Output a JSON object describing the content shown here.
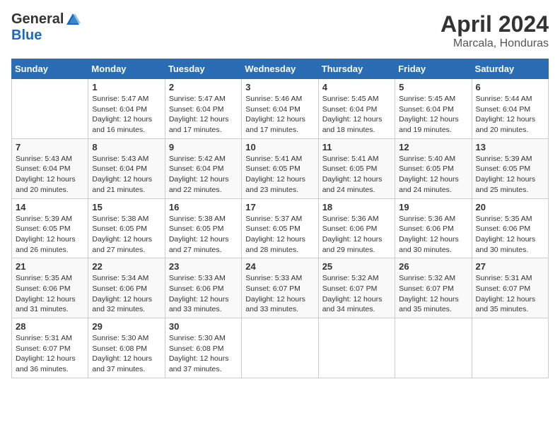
{
  "logo": {
    "general": "General",
    "blue": "Blue"
  },
  "header": {
    "month": "April 2024",
    "location": "Marcala, Honduras"
  },
  "days_of_week": [
    "Sunday",
    "Monday",
    "Tuesday",
    "Wednesday",
    "Thursday",
    "Friday",
    "Saturday"
  ],
  "weeks": [
    [
      {
        "day": "",
        "sunrise": "",
        "sunset": "",
        "daylight": ""
      },
      {
        "day": "1",
        "sunrise": "Sunrise: 5:47 AM",
        "sunset": "Sunset: 6:04 PM",
        "daylight": "Daylight: 12 hours and 16 minutes."
      },
      {
        "day": "2",
        "sunrise": "Sunrise: 5:47 AM",
        "sunset": "Sunset: 6:04 PM",
        "daylight": "Daylight: 12 hours and 17 minutes."
      },
      {
        "day": "3",
        "sunrise": "Sunrise: 5:46 AM",
        "sunset": "Sunset: 6:04 PM",
        "daylight": "Daylight: 12 hours and 17 minutes."
      },
      {
        "day": "4",
        "sunrise": "Sunrise: 5:45 AM",
        "sunset": "Sunset: 6:04 PM",
        "daylight": "Daylight: 12 hours and 18 minutes."
      },
      {
        "day": "5",
        "sunrise": "Sunrise: 5:45 AM",
        "sunset": "Sunset: 6:04 PM",
        "daylight": "Daylight: 12 hours and 19 minutes."
      },
      {
        "day": "6",
        "sunrise": "Sunrise: 5:44 AM",
        "sunset": "Sunset: 6:04 PM",
        "daylight": "Daylight: 12 hours and 20 minutes."
      }
    ],
    [
      {
        "day": "7",
        "sunrise": "Sunrise: 5:43 AM",
        "sunset": "Sunset: 6:04 PM",
        "daylight": "Daylight: 12 hours and 20 minutes."
      },
      {
        "day": "8",
        "sunrise": "Sunrise: 5:43 AM",
        "sunset": "Sunset: 6:04 PM",
        "daylight": "Daylight: 12 hours and 21 minutes."
      },
      {
        "day": "9",
        "sunrise": "Sunrise: 5:42 AM",
        "sunset": "Sunset: 6:04 PM",
        "daylight": "Daylight: 12 hours and 22 minutes."
      },
      {
        "day": "10",
        "sunrise": "Sunrise: 5:41 AM",
        "sunset": "Sunset: 6:05 PM",
        "daylight": "Daylight: 12 hours and 23 minutes."
      },
      {
        "day": "11",
        "sunrise": "Sunrise: 5:41 AM",
        "sunset": "Sunset: 6:05 PM",
        "daylight": "Daylight: 12 hours and 24 minutes."
      },
      {
        "day": "12",
        "sunrise": "Sunrise: 5:40 AM",
        "sunset": "Sunset: 6:05 PM",
        "daylight": "Daylight: 12 hours and 24 minutes."
      },
      {
        "day": "13",
        "sunrise": "Sunrise: 5:39 AM",
        "sunset": "Sunset: 6:05 PM",
        "daylight": "Daylight: 12 hours and 25 minutes."
      }
    ],
    [
      {
        "day": "14",
        "sunrise": "Sunrise: 5:39 AM",
        "sunset": "Sunset: 6:05 PM",
        "daylight": "Daylight: 12 hours and 26 minutes."
      },
      {
        "day": "15",
        "sunrise": "Sunrise: 5:38 AM",
        "sunset": "Sunset: 6:05 PM",
        "daylight": "Daylight: 12 hours and 27 minutes."
      },
      {
        "day": "16",
        "sunrise": "Sunrise: 5:38 AM",
        "sunset": "Sunset: 6:05 PM",
        "daylight": "Daylight: 12 hours and 27 minutes."
      },
      {
        "day": "17",
        "sunrise": "Sunrise: 5:37 AM",
        "sunset": "Sunset: 6:05 PM",
        "daylight": "Daylight: 12 hours and 28 minutes."
      },
      {
        "day": "18",
        "sunrise": "Sunrise: 5:36 AM",
        "sunset": "Sunset: 6:06 PM",
        "daylight": "Daylight: 12 hours and 29 minutes."
      },
      {
        "day": "19",
        "sunrise": "Sunrise: 5:36 AM",
        "sunset": "Sunset: 6:06 PM",
        "daylight": "Daylight: 12 hours and 30 minutes."
      },
      {
        "day": "20",
        "sunrise": "Sunrise: 5:35 AM",
        "sunset": "Sunset: 6:06 PM",
        "daylight": "Daylight: 12 hours and 30 minutes."
      }
    ],
    [
      {
        "day": "21",
        "sunrise": "Sunrise: 5:35 AM",
        "sunset": "Sunset: 6:06 PM",
        "daylight": "Daylight: 12 hours and 31 minutes."
      },
      {
        "day": "22",
        "sunrise": "Sunrise: 5:34 AM",
        "sunset": "Sunset: 6:06 PM",
        "daylight": "Daylight: 12 hours and 32 minutes."
      },
      {
        "day": "23",
        "sunrise": "Sunrise: 5:33 AM",
        "sunset": "Sunset: 6:06 PM",
        "daylight": "Daylight: 12 hours and 33 minutes."
      },
      {
        "day": "24",
        "sunrise": "Sunrise: 5:33 AM",
        "sunset": "Sunset: 6:07 PM",
        "daylight": "Daylight: 12 hours and 33 minutes."
      },
      {
        "day": "25",
        "sunrise": "Sunrise: 5:32 AM",
        "sunset": "Sunset: 6:07 PM",
        "daylight": "Daylight: 12 hours and 34 minutes."
      },
      {
        "day": "26",
        "sunrise": "Sunrise: 5:32 AM",
        "sunset": "Sunset: 6:07 PM",
        "daylight": "Daylight: 12 hours and 35 minutes."
      },
      {
        "day": "27",
        "sunrise": "Sunrise: 5:31 AM",
        "sunset": "Sunset: 6:07 PM",
        "daylight": "Daylight: 12 hours and 35 minutes."
      }
    ],
    [
      {
        "day": "28",
        "sunrise": "Sunrise: 5:31 AM",
        "sunset": "Sunset: 6:07 PM",
        "daylight": "Daylight: 12 hours and 36 minutes."
      },
      {
        "day": "29",
        "sunrise": "Sunrise: 5:30 AM",
        "sunset": "Sunset: 6:08 PM",
        "daylight": "Daylight: 12 hours and 37 minutes."
      },
      {
        "day": "30",
        "sunrise": "Sunrise: 5:30 AM",
        "sunset": "Sunset: 6:08 PM",
        "daylight": "Daylight: 12 hours and 37 minutes."
      },
      {
        "day": "",
        "sunrise": "",
        "sunset": "",
        "daylight": ""
      },
      {
        "day": "",
        "sunrise": "",
        "sunset": "",
        "daylight": ""
      },
      {
        "day": "",
        "sunrise": "",
        "sunset": "",
        "daylight": ""
      },
      {
        "day": "",
        "sunrise": "",
        "sunset": "",
        "daylight": ""
      }
    ]
  ]
}
